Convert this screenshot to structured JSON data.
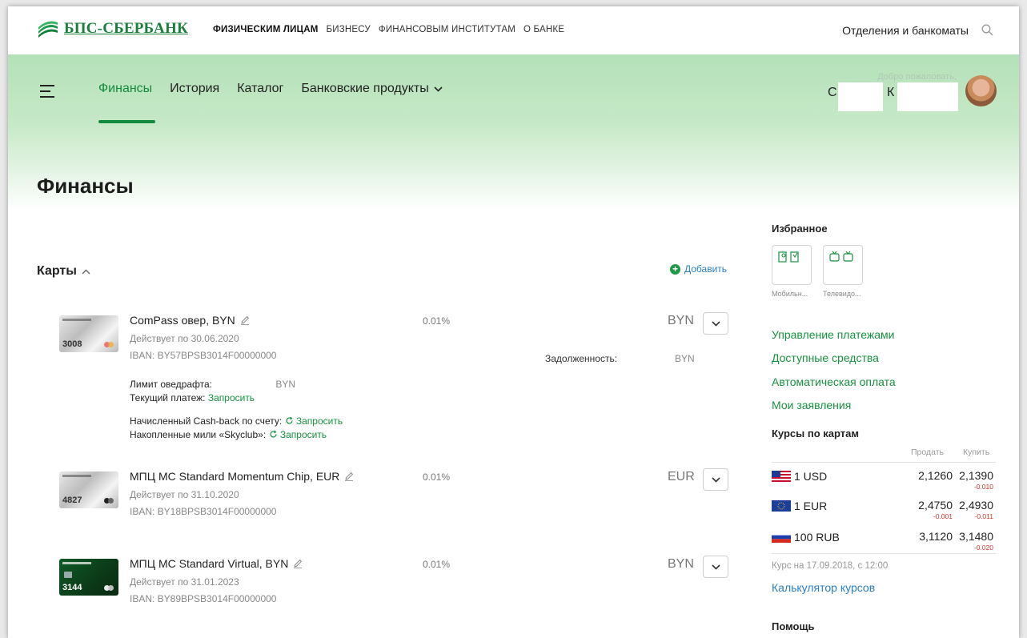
{
  "topbar": {
    "logo_text": "БПС-СБЕРБАНК",
    "nav": [
      "ФИЗИЧЕСКИМ ЛИЦАМ",
      "БИЗНЕСУ",
      "ФИНАНСОВЫМ ИНСТИТУТАМ",
      "О БАНКЕ"
    ],
    "branches_label": "Отделения и банкоматы"
  },
  "header": {
    "nav": [
      "Финансы",
      "История",
      "Каталог",
      "Банковские продукты"
    ],
    "active_nav": "Финансы",
    "welcome": "Добро пожаловать,",
    "user_initial_first": "С",
    "user_initial_last": "К"
  },
  "page": {
    "title": "Финансы"
  },
  "cards_section": {
    "title": "Карты",
    "add_label": "Добавить",
    "cards": [
      {
        "number": "3008",
        "name": "ComPass овер, BYN",
        "valid_until": "Действует по 30.06.2020",
        "iban": "IBAN: BY57BPSB3014F00000000",
        "rate": "0.01%",
        "currency": "BYN",
        "debt_label": "Задолженность:",
        "debt_currency": "BYN",
        "overdraft_label": "Лимит оведрафта:",
        "overdraft_currency": "BYN",
        "current_payment_label": "Текущий платеж:",
        "request_label": "Запросить",
        "cashback_label": "Начисленный Cash-back по счету:",
        "miles_label": "Накопленные мили «Skyclub»:"
      },
      {
        "number": "4827",
        "name": "МПЦ MC Standard Momentum Chip, EUR",
        "valid_until": "Действует по 31.10.2020",
        "iban": "IBAN: BY18BPSB3014F00000000",
        "rate": "0.01%",
        "currency": "EUR"
      },
      {
        "number": "3144",
        "name": "МПЦ MC Standard Virtual, BYN",
        "valid_until": "Действует по 31.01.2023",
        "iban": "IBAN: BY89BPSB3014F00000000",
        "rate": "0.01%",
        "currency": "BYN"
      }
    ]
  },
  "sidebar": {
    "favorites_title": "Избранное",
    "favorites": [
      "Мобильн...",
      "Телевидо..."
    ],
    "links": [
      "Управление платежами",
      "Доступные средства",
      "Автоматическая оплата",
      "Мои заявления"
    ],
    "rates": {
      "title": "Курсы по картам",
      "sell_label": "Продать",
      "buy_label": "Купить",
      "rows": [
        {
          "name": "1 USD",
          "sell": "2,1260",
          "buy": "2,1390",
          "sell_delta": "",
          "buy_delta": "-0.010"
        },
        {
          "name": "1 EUR",
          "sell": "2,4750",
          "buy": "2,4930",
          "sell_delta": "-0.001",
          "buy_delta": "-0.011"
        },
        {
          "name": "100 RUB",
          "sell": "3,1120",
          "buy": "3,1480",
          "sell_delta": "",
          "buy_delta": "-0.020"
        }
      ],
      "note": "Курс на 17.09.2018, с 12:00",
      "calculator": "Калькулятор курсов"
    },
    "help_title": "Помощь"
  },
  "colors": {
    "brand_green": "#148a3e",
    "link_green": "#17913f",
    "link_blue": "#2a7fc3",
    "delta_red": "#d0342c"
  }
}
